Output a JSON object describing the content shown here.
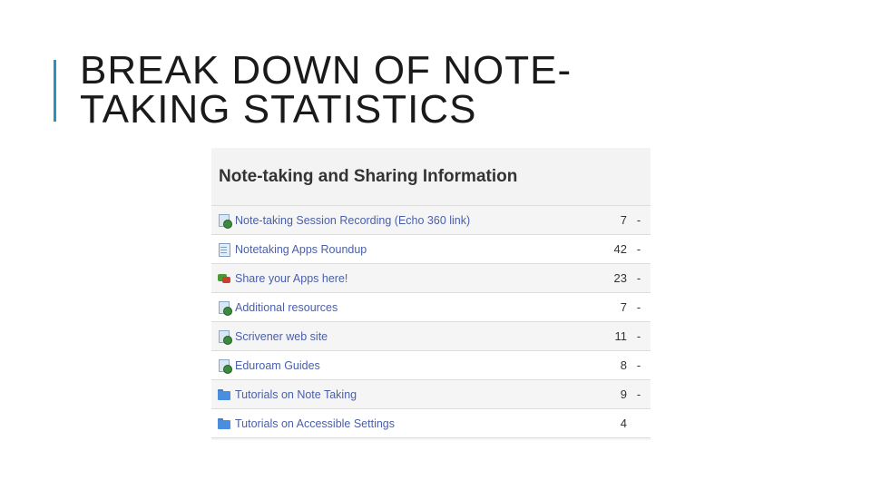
{
  "slide": {
    "title_line1": "BREAK DOWN OF NOTE-",
    "title_line2": "TAKING STATISTICS",
    "accent_color": "#2f8ec4"
  },
  "panel": {
    "heading": "Note-taking and Sharing Information",
    "rows": [
      {
        "icon": "link-icon",
        "label": "Note-taking Session Recording (Echo 360 link)",
        "count": "7",
        "dash": "-"
      },
      {
        "icon": "document-icon",
        "label": "Notetaking Apps Roundup",
        "count": "42",
        "dash": "-"
      },
      {
        "icon": "forum-icon",
        "label": "Share your Apps here!",
        "count": "23",
        "dash": "-"
      },
      {
        "icon": "link-icon",
        "label": "Additional resources",
        "count": "7",
        "dash": "-"
      },
      {
        "icon": "link-icon",
        "label": "Scrivener web site",
        "count": "11",
        "dash": "-"
      },
      {
        "icon": "link-icon",
        "label": "Eduroam Guides",
        "count": "8",
        "dash": "-"
      },
      {
        "icon": "folder-icon",
        "label": "Tutorials on Note Taking",
        "count": "9",
        "dash": "-"
      },
      {
        "icon": "folder-icon",
        "label": "Tutorials on Accessible Settings",
        "count": "4",
        "dash": ""
      }
    ],
    "link_color": "#4a5fa8"
  }
}
